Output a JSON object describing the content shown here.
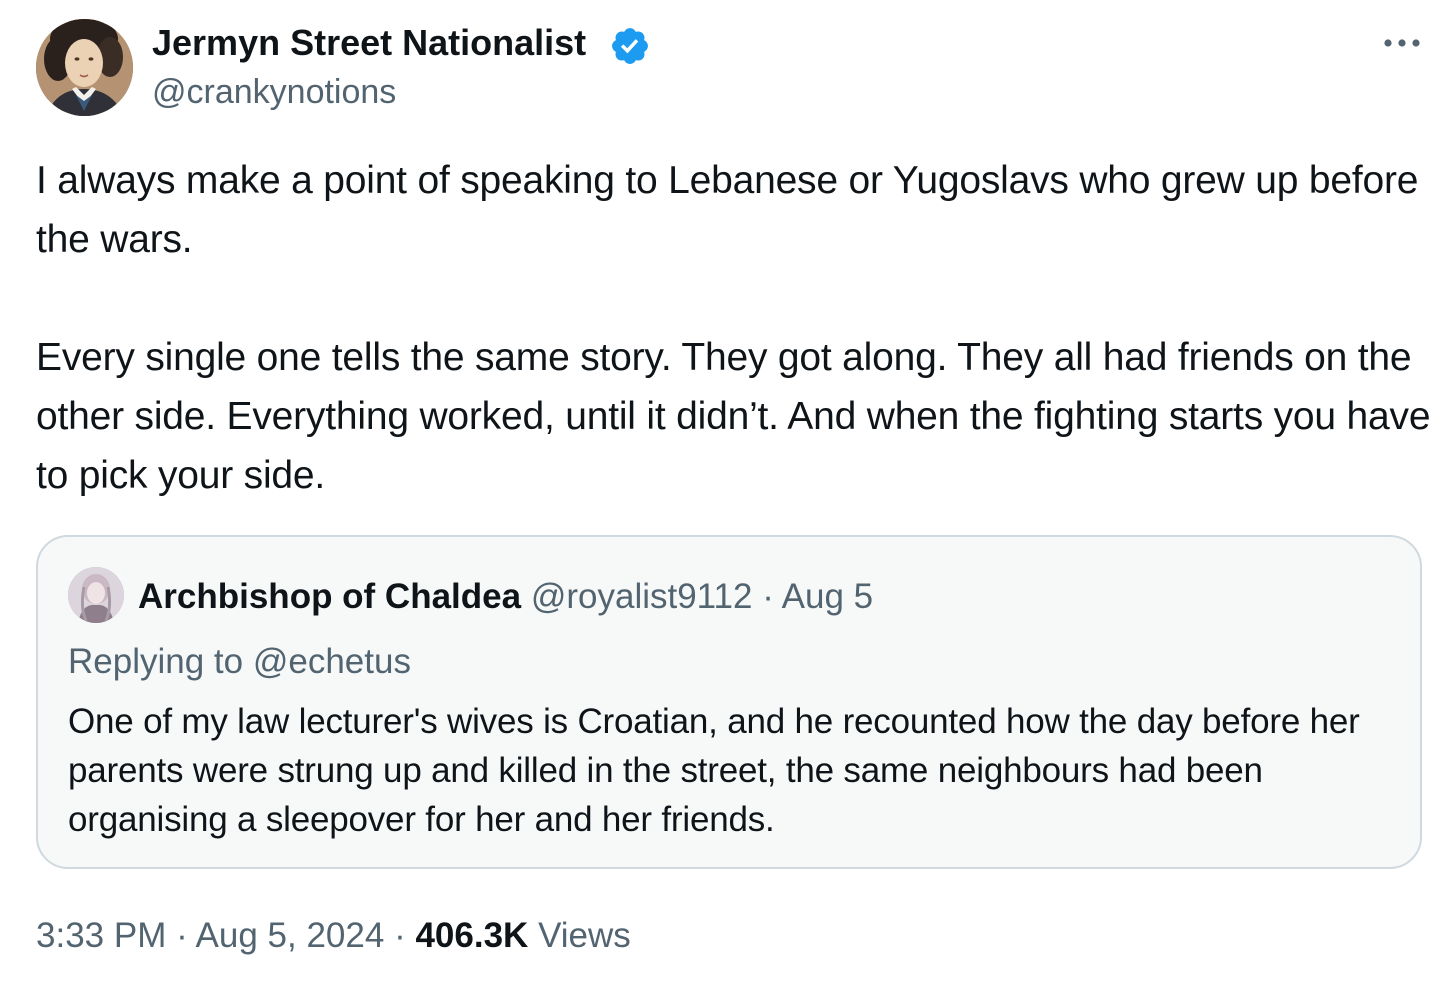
{
  "author": {
    "display_name": "Jermyn Street Nationalist",
    "handle": "@crankynotions",
    "verified": true,
    "verified_icon": "verified-badge-icon",
    "accent_color": "#1d9bf0"
  },
  "more_icon": "more-horizontal-icon",
  "tweet": {
    "text": "I always make a point of speaking to Lebanese or Yugoslavs who grew up before the wars.\n\nEvery single one tells the same story. They got along. They all had friends on the other side. Everything worked, until it didn’t. And when the fighting starts you have to pick your side."
  },
  "quote": {
    "display_name": "Archbishop of Chaldea",
    "handle": "@royalist9112",
    "separator": "·",
    "date": "Aug 5",
    "replying_prefix": "Replying to",
    "replying_to": "@echetus",
    "text": "One of my law lecturer's wives is Croatian, and he recounted how the day before her parents were strung up and killed in the street, the same neighbours had been organising a sleepover for her and her friends."
  },
  "footer": {
    "time": "3:33 PM",
    "sep1": "·",
    "date": "Aug 5, 2024",
    "sep2": "·",
    "views_count": "406.3K",
    "views_label": "Views"
  }
}
